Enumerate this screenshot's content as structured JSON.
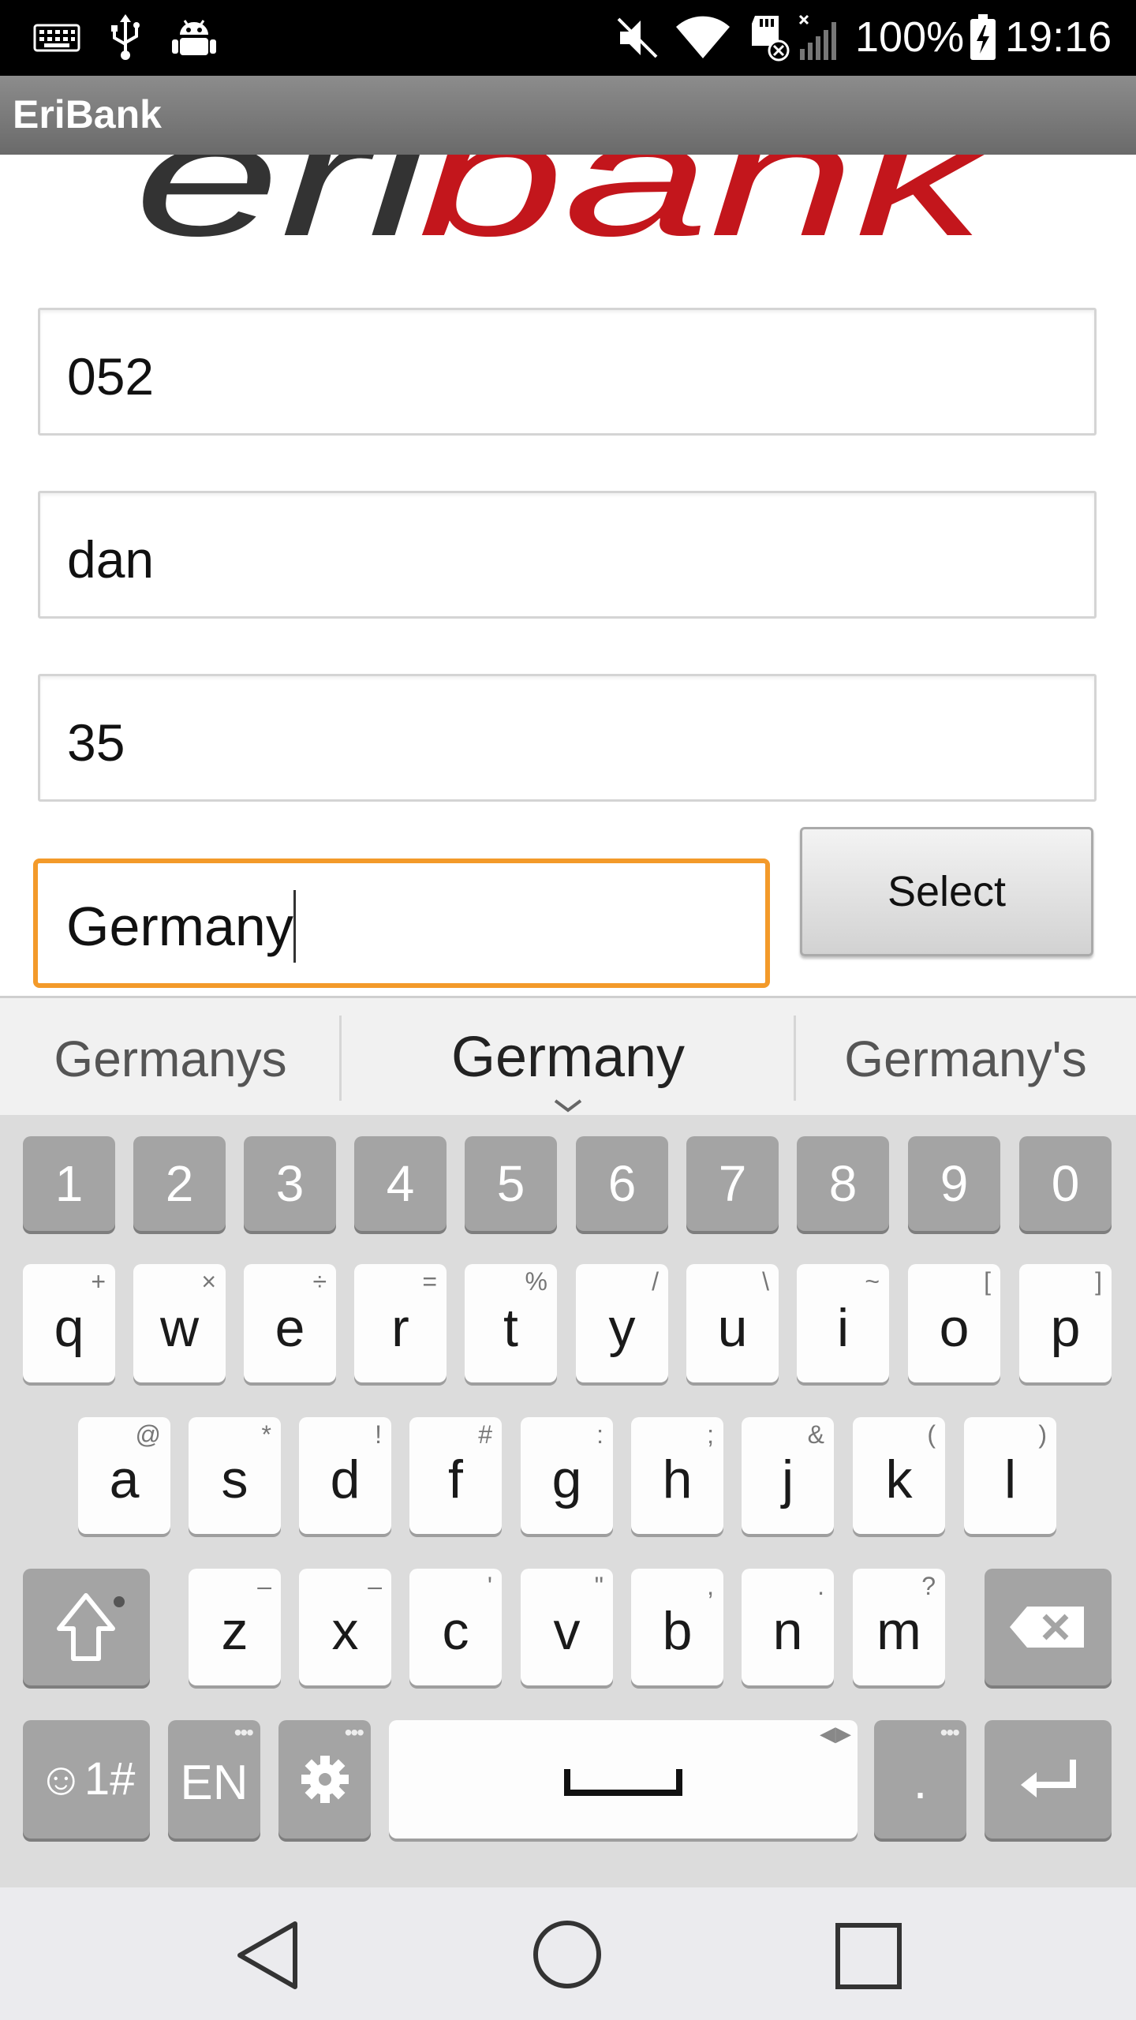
{
  "status_bar": {
    "battery": "100%",
    "time": "19:16",
    "icons": [
      "keyboard-icon",
      "usb-icon",
      "android-debug-icon",
      "mute-icon",
      "wifi-icon",
      "sd-card-icon",
      "signal-off-icon",
      "battery-charging-icon"
    ]
  },
  "app": {
    "title": "EriBank"
  },
  "form": {
    "phone_value": "052",
    "name_value": "dan",
    "amount_value": "35",
    "country_value": "Germany",
    "select_label": "Select"
  },
  "keyboard": {
    "suggestions": [
      "Germanys",
      "Germany",
      "Germany's"
    ],
    "numbers": [
      "1",
      "2",
      "3",
      "4",
      "5",
      "6",
      "7",
      "8",
      "9",
      "0"
    ],
    "row1": [
      {
        "k": "q",
        "h": "+"
      },
      {
        "k": "w",
        "h": "×"
      },
      {
        "k": "e",
        "h": "÷"
      },
      {
        "k": "r",
        "h": "="
      },
      {
        "k": "t",
        "h": "%"
      },
      {
        "k": "y",
        "h": "/"
      },
      {
        "k": "u",
        "h": "\\"
      },
      {
        "k": "i",
        "h": "~"
      },
      {
        "k": "o",
        "h": "["
      },
      {
        "k": "p",
        "h": "]"
      }
    ],
    "row2": [
      {
        "k": "a",
        "h": "@"
      },
      {
        "k": "s",
        "h": "*"
      },
      {
        "k": "d",
        "h": "!"
      },
      {
        "k": "f",
        "h": "#"
      },
      {
        "k": "g",
        "h": ":"
      },
      {
        "k": "h",
        "h": ";"
      },
      {
        "k": "j",
        "h": "&"
      },
      {
        "k": "k",
        "h": "("
      },
      {
        "k": "l",
        "h": ")"
      }
    ],
    "row3": [
      {
        "k": "z",
        "h": "–"
      },
      {
        "k": "x",
        "h": "–"
      },
      {
        "k": "c",
        "h": "'"
      },
      {
        "k": "v",
        "h": "\""
      },
      {
        "k": "b",
        "h": ","
      },
      {
        "k": "n",
        "h": "."
      },
      {
        "k": "m",
        "h": "?"
      }
    ],
    "symbols_label": "☺1#",
    "lang_label": "EN",
    "period_label": "."
  }
}
